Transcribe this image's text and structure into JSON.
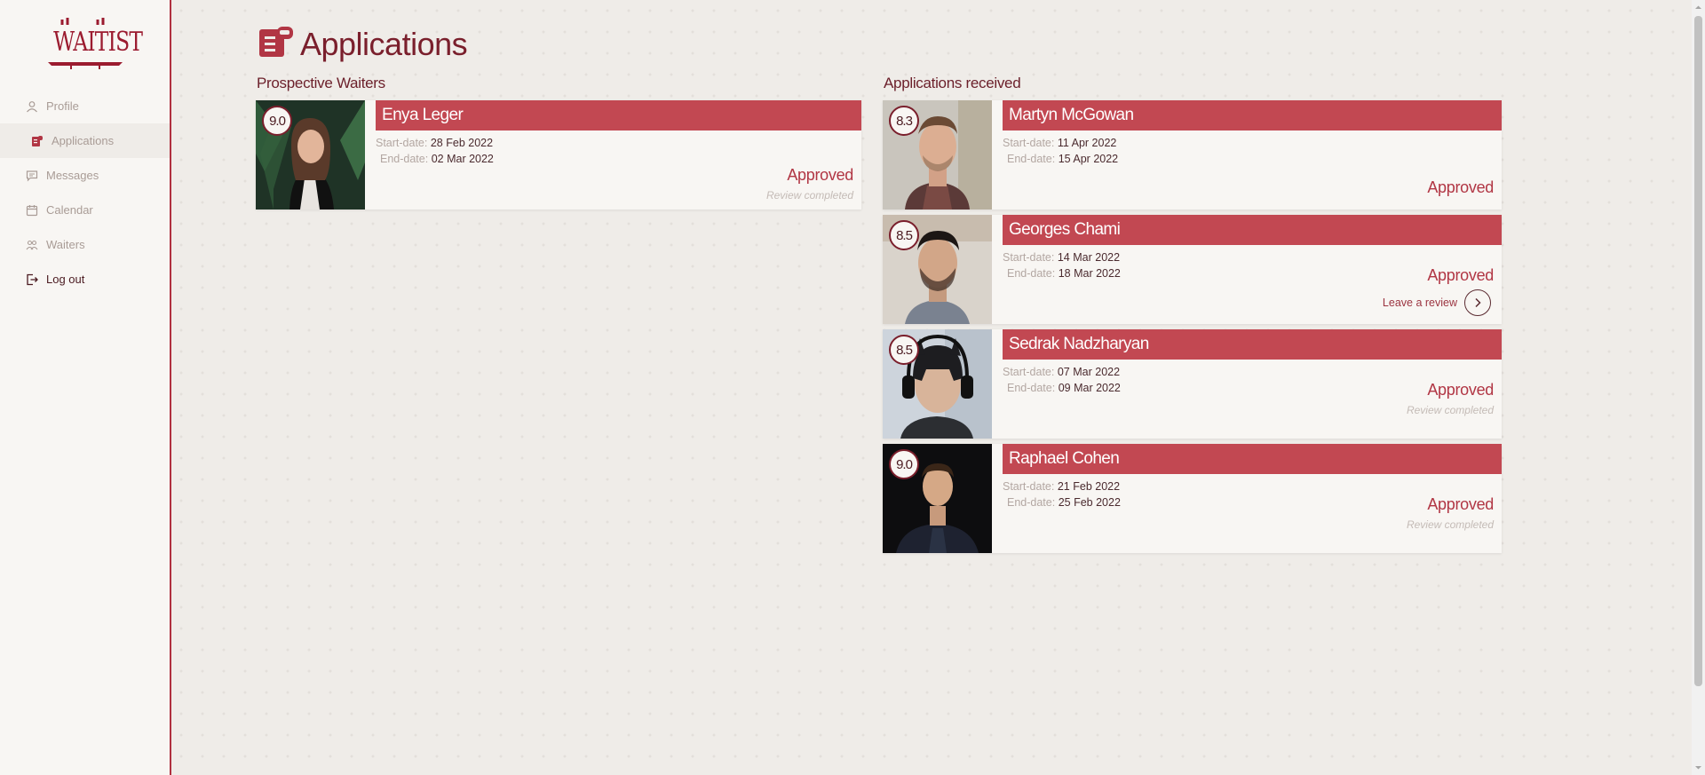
{
  "app": {
    "logo_text": "WAITIST"
  },
  "sidebar": {
    "items": [
      {
        "label": "Profile",
        "icon": "user-icon"
      },
      {
        "label": "Applications",
        "icon": "scroll-icon",
        "active": true
      },
      {
        "label": "Messages",
        "icon": "chat-icon"
      },
      {
        "label": "Calendar",
        "icon": "calendar-icon"
      },
      {
        "label": "Waiters",
        "icon": "people-icon"
      },
      {
        "label": "Log out",
        "icon": "logout-icon"
      }
    ]
  },
  "page": {
    "title": "Applications",
    "icon": "scroll-icon"
  },
  "prospective": {
    "title": "Prospective Waiters",
    "cards": [
      {
        "rating": "9.0",
        "name": "Enya Leger",
        "start_label": "Start-date:",
        "start": "28 Feb 2022",
        "end_label": "End-date:",
        "end": "02 Mar 2022",
        "status": "Approved",
        "review": "Review completed"
      }
    ]
  },
  "received": {
    "title": "Applications received",
    "cards": [
      {
        "rating": "8.3",
        "name": "Martyn McGowan",
        "start_label": "Start-date:",
        "start": "11 Apr 2022",
        "end_label": "End-date:",
        "end": "15 Apr 2022",
        "status": "Approved"
      },
      {
        "rating": "8.5",
        "name": "Georges Chami",
        "start_label": "Start-date:",
        "start": "14 Mar 2022",
        "end_label": "End-date:",
        "end": "18 Mar 2022",
        "status": "Approved",
        "action": "Leave a review"
      },
      {
        "rating": "8.5",
        "name": "Sedrak Nadzharyan",
        "start_label": "Start-date:",
        "start": "07 Mar 2022",
        "end_label": "End-date:",
        "end": "09 Mar 2022",
        "status": "Approved",
        "review": "Review completed"
      },
      {
        "rating": "9.0",
        "name": "Raphael Cohen",
        "start_label": "Start-date:",
        "start": "21 Feb 2022",
        "end_label": "End-date:",
        "end": "25 Feb 2022",
        "status": "Approved",
        "review": "Review completed"
      }
    ]
  },
  "colors": {
    "accent": "#c24852",
    "text_dark": "#6b1f2a",
    "background": "#efece8"
  }
}
